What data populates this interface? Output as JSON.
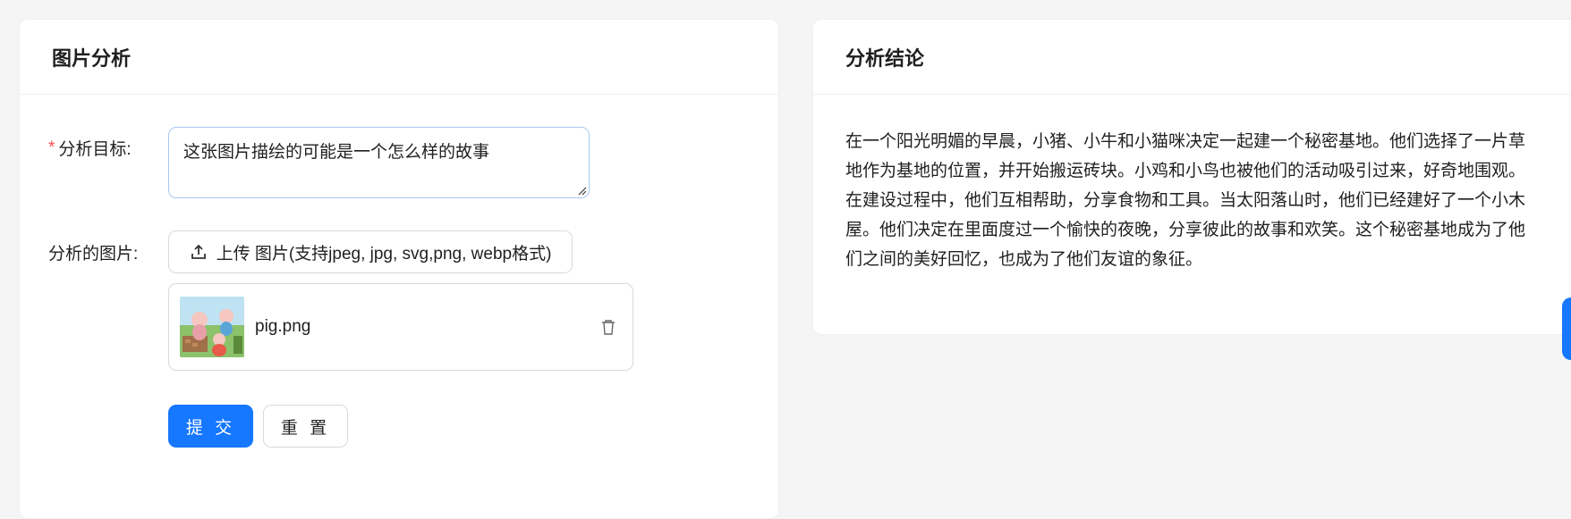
{
  "analysis_card": {
    "title": "图片分析",
    "target_label": "分析目标:",
    "target_value": "这张图片描绘的可能是一个怎么样的故事",
    "image_label": "分析的图片:",
    "upload_label": "上传 图片(支持jpeg, jpg, svg,png, webp格式)",
    "file_name": "pig.png",
    "submit_label": "提 交",
    "reset_label": "重 置"
  },
  "conclusion_card": {
    "title": "分析结论",
    "text": "在一个阳光明媚的早晨，小猪、小牛和小猫咪决定一起建一个秘密基地。他们选择了一片草地作为基地的位置，并开始搬运砖块。小鸡和小鸟也被他们的活动吸引过来，好奇地围观。 在建设过程中，他们互相帮助，分享食物和工具。当太阳落山时，他们已经建好了一个小木屋。他们决定在里面度过一个愉快的夜晚，分享彼此的故事和欢笑。这个秘密基地成为了他们之间的美好回忆，也成为了他们友谊的象征。"
  },
  "colors": {
    "primary": "#1677ff",
    "required": "#ff4d4f",
    "background": "#f5f5f5"
  },
  "icons": [
    "upload-icon",
    "delete-icon",
    "resize-handle-icon"
  ]
}
